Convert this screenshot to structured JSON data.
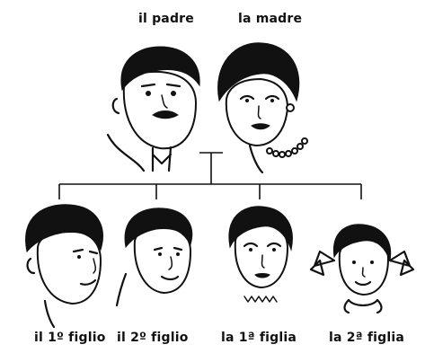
{
  "parents": {
    "father_label": "il padre",
    "mother_label": "la madre"
  },
  "children": [
    {
      "label": "il 1º figlio"
    },
    {
      "label": "il 2º figlio"
    },
    {
      "label": "la 1ª figlia"
    },
    {
      "label": "la 2ª figlia"
    }
  ],
  "colors": {
    "ink": "#111111",
    "background": "#ffffff"
  }
}
